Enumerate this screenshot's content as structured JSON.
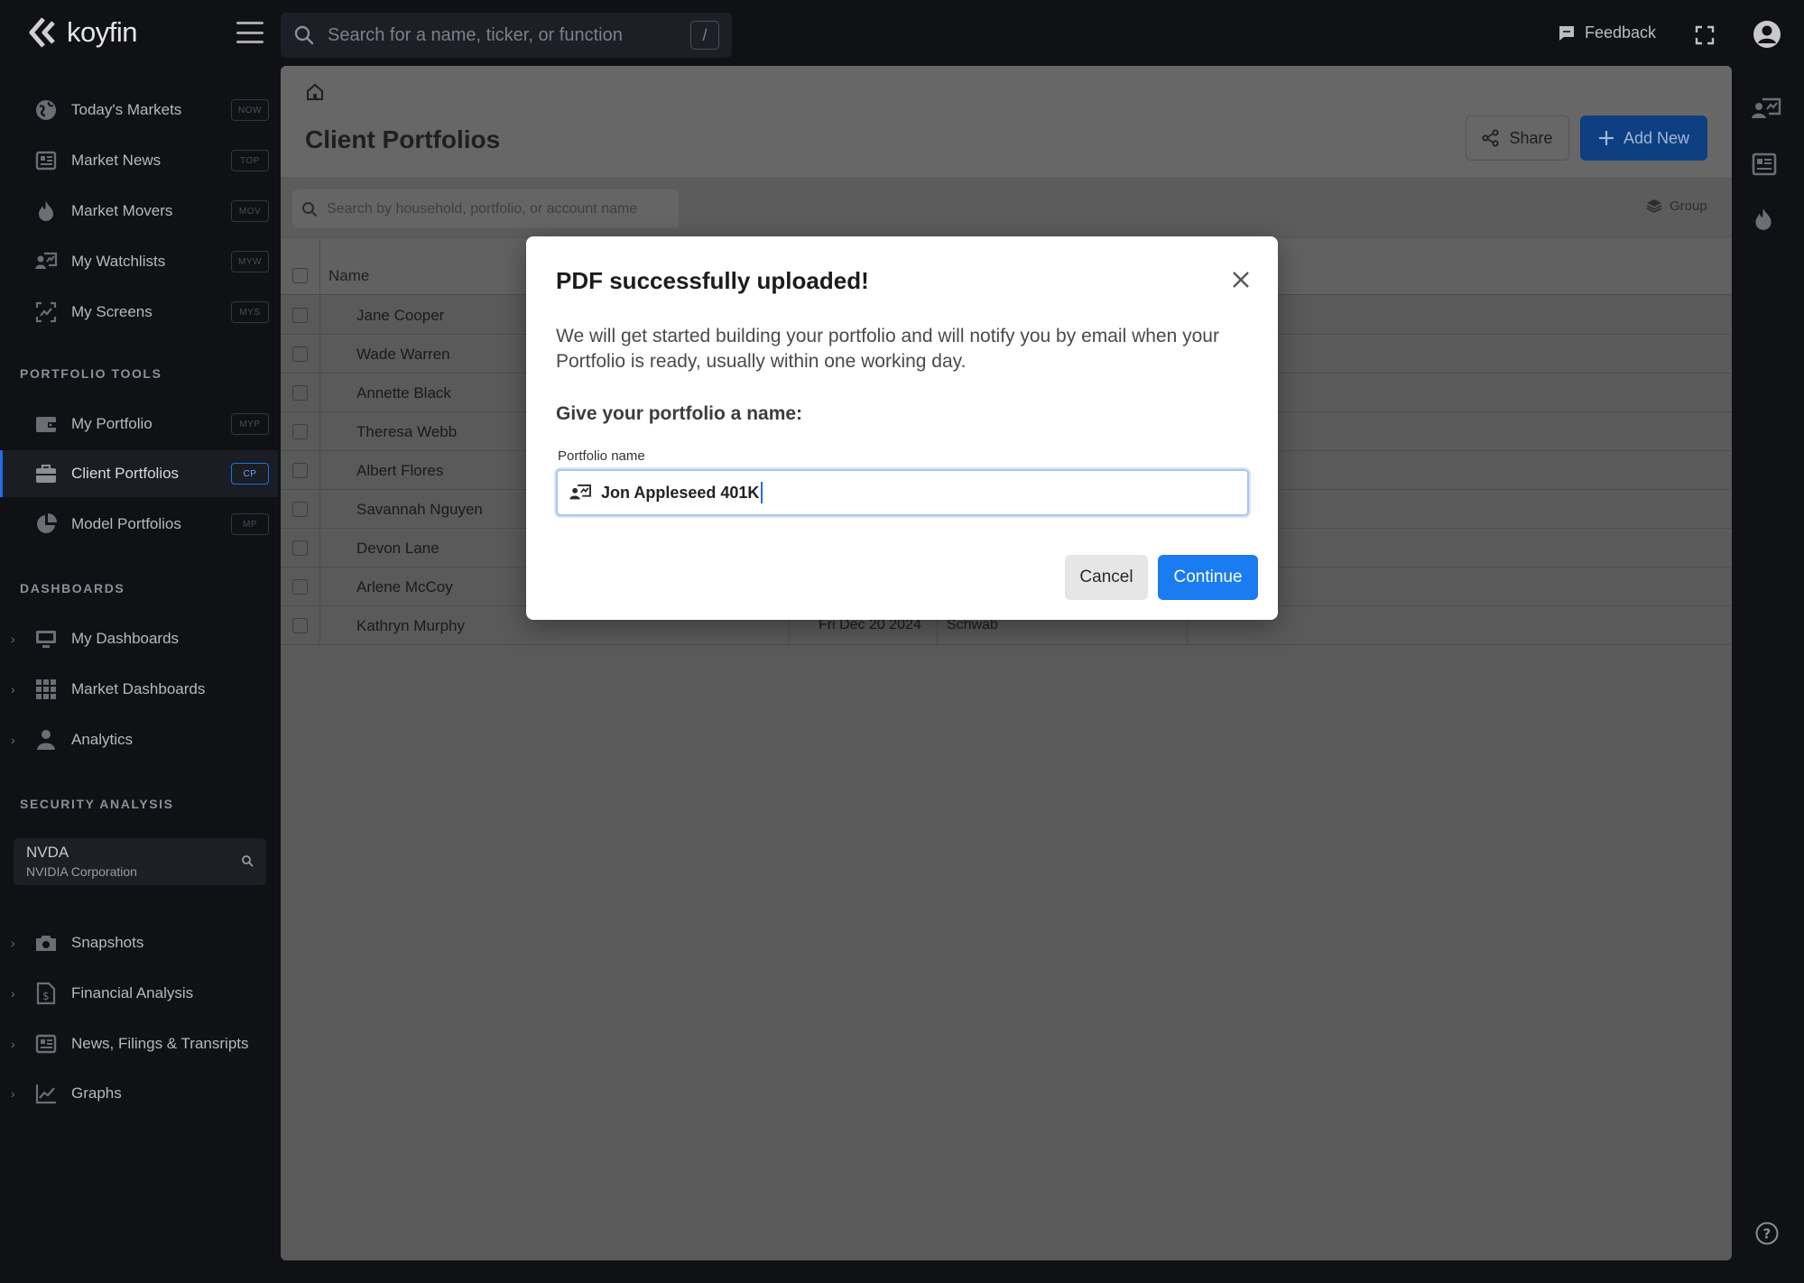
{
  "app": {
    "name": "koyfin"
  },
  "topbar": {
    "search_placeholder": "Search for a name, ticker, or function",
    "search_shortcut": "/",
    "feedback_label": "Feedback"
  },
  "sidebar": {
    "main_items": [
      {
        "label": "Today's Markets",
        "shortcut": "NOW",
        "icon": "globe-icon"
      },
      {
        "label": "Market News",
        "shortcut": "TOP",
        "icon": "newspaper-icon"
      },
      {
        "label": "Market Movers",
        "shortcut": "MOV",
        "icon": "flame-icon"
      },
      {
        "label": "My Watchlists",
        "shortcut": "MYW",
        "icon": "watchlist-icon"
      },
      {
        "label": "My Screens",
        "shortcut": "MYS",
        "icon": "screen-icon"
      }
    ],
    "portfolio_tools_label": "PORTFOLIO TOOLS",
    "portfolio_items": [
      {
        "label": "My Portfolio",
        "shortcut": "MYP",
        "icon": "wallet-icon"
      },
      {
        "label": "Client Portfolios",
        "shortcut": "CP",
        "icon": "briefcase-icon",
        "active": true
      },
      {
        "label": "Model Portfolios",
        "shortcut": "MP",
        "icon": "pie-chart-icon"
      }
    ],
    "dashboards_label": "DASHBOARDS",
    "dashboard_items": [
      {
        "label": "My Dashboards",
        "icon": "monitor-icon"
      },
      {
        "label": "Market Dashboards",
        "icon": "grid-icon"
      },
      {
        "label": "Analytics",
        "icon": "person-icon"
      }
    ],
    "security_analysis_label": "SECURITY ANALYSIS",
    "ticker": {
      "symbol": "NVDA",
      "company": "NVIDIA Corporation"
    },
    "security_items": [
      {
        "label": "Snapshots",
        "icon": "camera-icon"
      },
      {
        "label": "Financial Analysis",
        "icon": "dollar-doc-icon"
      },
      {
        "label": "News, Filings & Transripts",
        "icon": "newspaper-icon"
      },
      {
        "label": "Graphs",
        "icon": "line-chart-icon"
      }
    ]
  },
  "main": {
    "title": "Client Portfolios",
    "share_label": "Share",
    "add_new_label": "Add New",
    "table_search_placeholder": "Search by household, portfolio, or account name",
    "group_label": "Group",
    "columns": {
      "name": "Name"
    },
    "rows": [
      {
        "name": "Jane Cooper"
      },
      {
        "name": "Wade Warren"
      },
      {
        "name": "Annette Black"
      },
      {
        "name": "Theresa Webb"
      },
      {
        "name": "Albert Flores"
      },
      {
        "name": "Savannah Nguyen"
      },
      {
        "name": "Devon Lane"
      },
      {
        "name": "Arlene McCoy"
      },
      {
        "name": "Kathryn Murphy",
        "date": "Fri Dec 20 2024",
        "custodian": "Schwab"
      }
    ]
  },
  "modal": {
    "title": "PDF successfully uploaded!",
    "body": "We will get started building your portfolio and will notify you by email when your Portfolio is ready, usually within one working day.",
    "subtitle": "Give your portfolio a name:",
    "field_label": "Portfolio name",
    "field_value": "Jon Appleseed 401K",
    "cancel_label": "Cancel",
    "continue_label": "Continue"
  },
  "colors": {
    "accent": "#1a7cf0",
    "sidebar_bg": "#0f1115",
    "overlay_main": "#5a5a5a",
    "active_marker": "#1f6fe5"
  }
}
